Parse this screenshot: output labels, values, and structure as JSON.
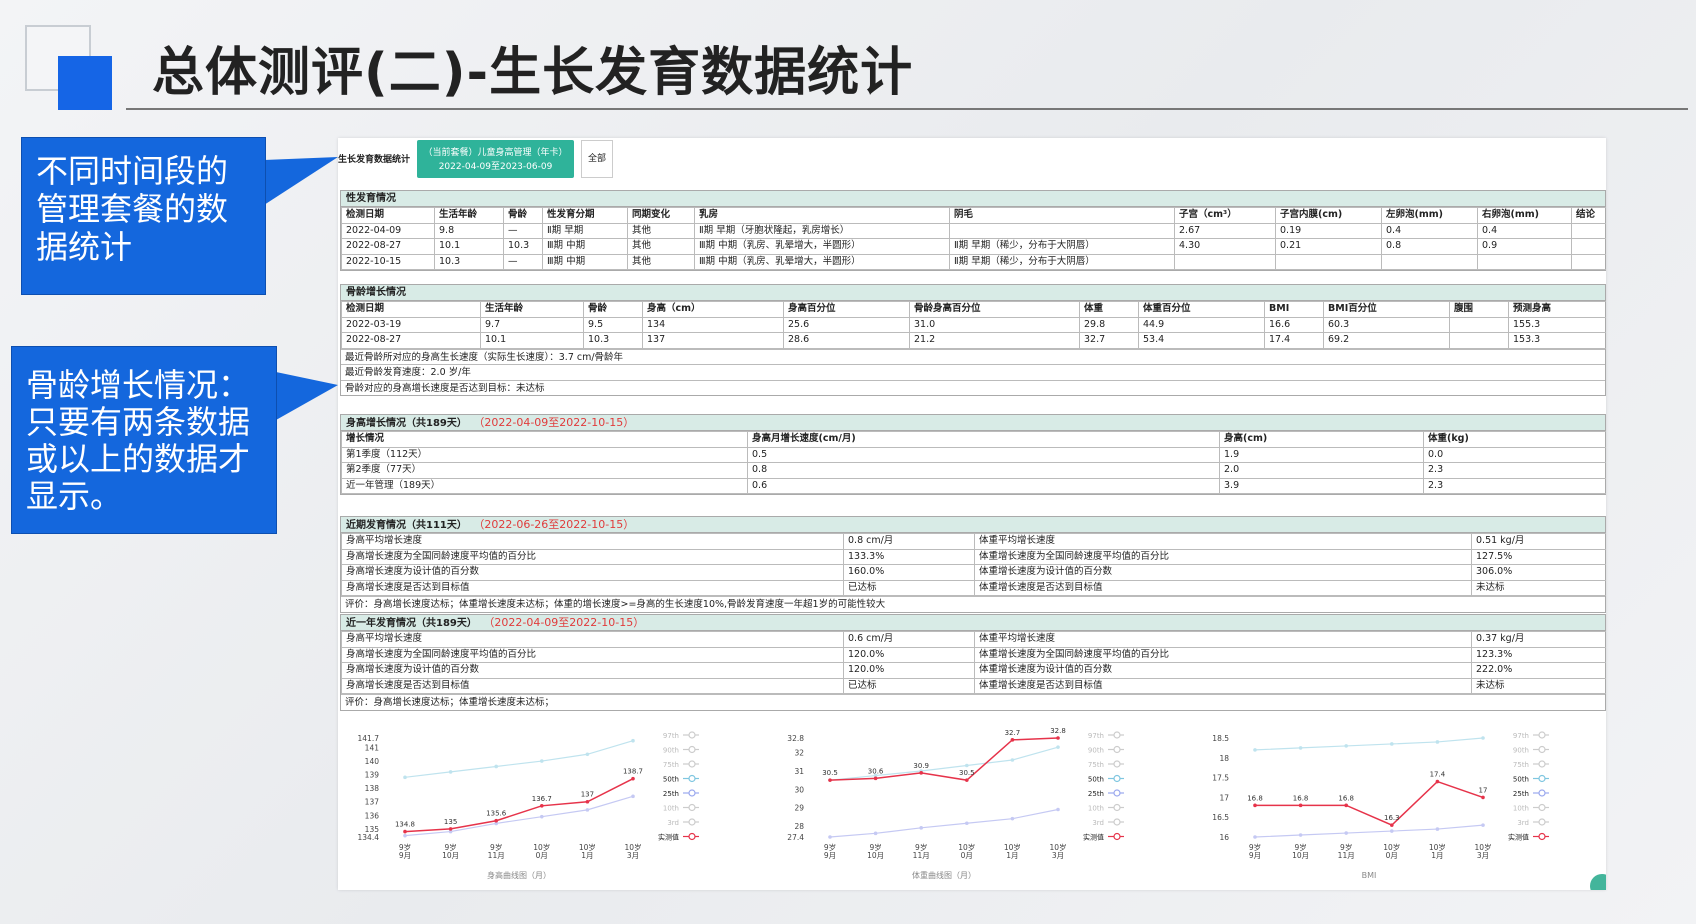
{
  "slide": {
    "title": "总体测评(二)-生长发育数据统计"
  },
  "callouts": [
    {
      "text": "不同时间段的管理套餐的数据统计"
    },
    {
      "text": "骨龄增长情况：只要有两条数据或以上的数据才显示。"
    }
  ],
  "topbar": {
    "label": "生长发育数据统计",
    "package_title": "（当前套餐）儿童身高管理（年卡）",
    "package_range": "2022-04-09至2023-06-09",
    "all_button": "全部"
  },
  "puberty": {
    "title": "性发育情况",
    "headers": [
      "检测日期",
      "生活年龄",
      "骨龄",
      "性发育分期",
      "同期变化",
      "乳房",
      "阴毛",
      "子宫（cm³）",
      "子宫内膜(cm)",
      "左卵泡(mm)",
      "右卵泡(mm)",
      "结论"
    ],
    "rows": [
      [
        "2022-04-09",
        "9.8",
        "—",
        "Ⅱ期 早期",
        "其他",
        "Ⅱ期 早期（牙胞状隆起，乳房增长）",
        "",
        "2.67",
        "0.19",
        "0.4",
        "0.4",
        ""
      ],
      [
        "2022-08-27",
        "10.1",
        "10.3",
        "Ⅲ期 中期",
        "其他",
        "Ⅲ期 中期（乳房、乳晕增大，半圆形）",
        "Ⅱ期 早期（稀少，分布于大阴唇）",
        "4.30",
        "0.21",
        "0.8",
        "0.9",
        ""
      ],
      [
        "2022-10-15",
        "10.3",
        "—",
        "Ⅲ期 中期",
        "其他",
        "Ⅲ期 中期（乳房、乳晕增大，半圆形）",
        "Ⅱ期 早期（稀少，分布于大阴唇）",
        "",
        "",
        "",
        "",
        ""
      ]
    ]
  },
  "boneage": {
    "title": "骨龄增长情况",
    "headers": [
      "检测日期",
      "生活年龄",
      "骨龄",
      "身高（cm）",
      "身高百分位",
      "骨龄身高百分位",
      "体重",
      "体重百分位",
      "BMI",
      "BMI百分位",
      "腹围",
      "预测身高"
    ],
    "rows": [
      [
        "2022-03-19",
        "9.7",
        "9.5",
        "134",
        "25.6",
        "31.0",
        "29.8",
        "44.9",
        "16.6",
        "60.3",
        "",
        "155.3"
      ],
      [
        "2022-08-27",
        "10.1",
        "10.3",
        "137",
        "28.6",
        "21.2",
        "32.7",
        "53.4",
        "17.4",
        "69.2",
        "",
        "153.3"
      ]
    ],
    "notes": [
      "最近骨龄所对应的身高生长速度（实际生长速度）：3.7 cm/骨龄年",
      "最近骨龄发育速度：2.0 岁/年",
      "骨龄对应的身高增长速度是否达到目标：未达标"
    ]
  },
  "heightgrowth": {
    "title": "身高增长情况（共189天）",
    "range": "（2022-04-09至2022-10-15）",
    "headers": [
      "增长情况",
      "身高月增长速度(cm/月)",
      "身高(cm)",
      "体重(kg)"
    ],
    "rows": [
      [
        "第1季度（112天）",
        "0.5",
        "1.9",
        "0.0"
      ],
      [
        "第2季度（77天）",
        "0.8",
        "2.0",
        "2.3"
      ],
      [
        "近一年管理（189天）",
        "0.6",
        "3.9",
        "2.3"
      ]
    ]
  },
  "recent": {
    "title": "近期发育情况（共111天）",
    "range": "（2022-06-26至2022-10-15）",
    "rows": [
      [
        "身高平均增长速度",
        "0.8 cm/月",
        "体重平均增长速度",
        "0.51 kg/月"
      ],
      [
        "身高增长速度为全国同龄速度平均值的百分比",
        "133.3%",
        "体重增长速度为全国同龄速度平均值的百分比",
        "127.5%"
      ],
      [
        "身高增长速度为设计值的百分数",
        "160.0%",
        "体重增长速度为设计值的百分数",
        "306.0%"
      ],
      [
        "身高增长速度是否达到目标值",
        "已达标",
        "体重增长速度是否达到目标值",
        "未达标"
      ]
    ],
    "eval": "评价：身高增长速度达标；体重增长速度未达标；体重的增长速度>=身高的生长速度10%,骨龄发育速度一年超1岁的可能性较大"
  },
  "yearly": {
    "title": "近一年发育情况（共189天）",
    "range": "（2022-04-09至2022-10-15）",
    "rows": [
      [
        "身高平均增长速度",
        "0.6 cm/月",
        "体重平均增长速度",
        "0.37 kg/月"
      ],
      [
        "身高增长速度为全国同龄速度平均值的百分比",
        "120.0%",
        "体重增长速度为全国同龄速度平均值的百分比",
        "123.3%"
      ],
      [
        "身高增长速度为设计值的百分数",
        "120.0%",
        "体重增长速度为设计值的百分数",
        "222.0%"
      ],
      [
        "身高增长速度是否达到目标值",
        "已达标",
        "体重增长速度是否达到目标值",
        "未达标"
      ]
    ],
    "eval": "评价：身高增长速度达标；体重增长速度未达标；"
  },
  "legend": [
    "97th",
    "90th",
    "75th",
    "50th",
    "25th",
    "10th",
    "3rd",
    "实测值"
  ],
  "chart_data": [
    {
      "type": "line",
      "title": "身高曲线图（月）",
      "categories": [
        [
          "9岁",
          "9月"
        ],
        [
          "9岁",
          "10月"
        ],
        [
          "9岁",
          "11月"
        ],
        [
          "10岁",
          "0月"
        ],
        [
          "10岁",
          "1月"
        ],
        [
          "10岁",
          "3月"
        ]
      ],
      "yticks": [
        "141.7",
        "141",
        "140",
        "139",
        "138",
        "137",
        "136",
        "135",
        "134.4"
      ],
      "ylim": [
        134.4,
        141.7
      ],
      "measured": [
        134.8,
        135,
        135.6,
        136.7,
        137,
        138.7
      ],
      "upper": [
        138.8,
        139.2,
        139.6,
        140.0,
        140.5,
        141.5
      ],
      "lower": [
        134.5,
        134.8,
        135.4,
        135.9,
        136.4,
        137.4
      ]
    },
    {
      "type": "line",
      "title": "体重曲线图（月）",
      "categories": [
        [
          "9岁",
          "9月"
        ],
        [
          "9岁",
          "10月"
        ],
        [
          "9岁",
          "11月"
        ],
        [
          "10岁",
          "0月"
        ],
        [
          "10岁",
          "1月"
        ],
        [
          "10岁",
          "3月"
        ]
      ],
      "yticks": [
        "32.8",
        "32",
        "31",
        "30",
        "29",
        "28",
        "27.4"
      ],
      "ylim": [
        27.4,
        32.8
      ],
      "measured": [
        30.5,
        30.6,
        30.9,
        30.5,
        32.7,
        32.8
      ],
      "upper": [
        30.5,
        30.75,
        31.0,
        31.3,
        31.6,
        32.3
      ],
      "lower": [
        27.4,
        27.6,
        27.9,
        28.15,
        28.4,
        28.9
      ]
    },
    {
      "type": "line",
      "title": "BMI",
      "categories": [
        [
          "9岁",
          "9月"
        ],
        [
          "9岁",
          "10月"
        ],
        [
          "9岁",
          "11月"
        ],
        [
          "10岁",
          "0月"
        ],
        [
          "10岁",
          "1月"
        ],
        [
          "10岁",
          "3月"
        ]
      ],
      "yticks": [
        "18.5",
        "18",
        "17.5",
        "17",
        "16.5",
        "16"
      ],
      "ylim": [
        16,
        18.5
      ],
      "measured": [
        16.8,
        16.8,
        16.8,
        16.3,
        17.4,
        17
      ],
      "upper": [
        18.2,
        18.25,
        18.3,
        18.35,
        18.4,
        18.5
      ],
      "lower": [
        16.0,
        16.05,
        16.1,
        16.15,
        16.2,
        16.3
      ]
    }
  ],
  "colors": {
    "accent": "#1565e6",
    "measured": "#e6334a",
    "pkg": "#2fb39a",
    "header_bg": "#d8ebe6",
    "range_red": "#e03b3b"
  }
}
